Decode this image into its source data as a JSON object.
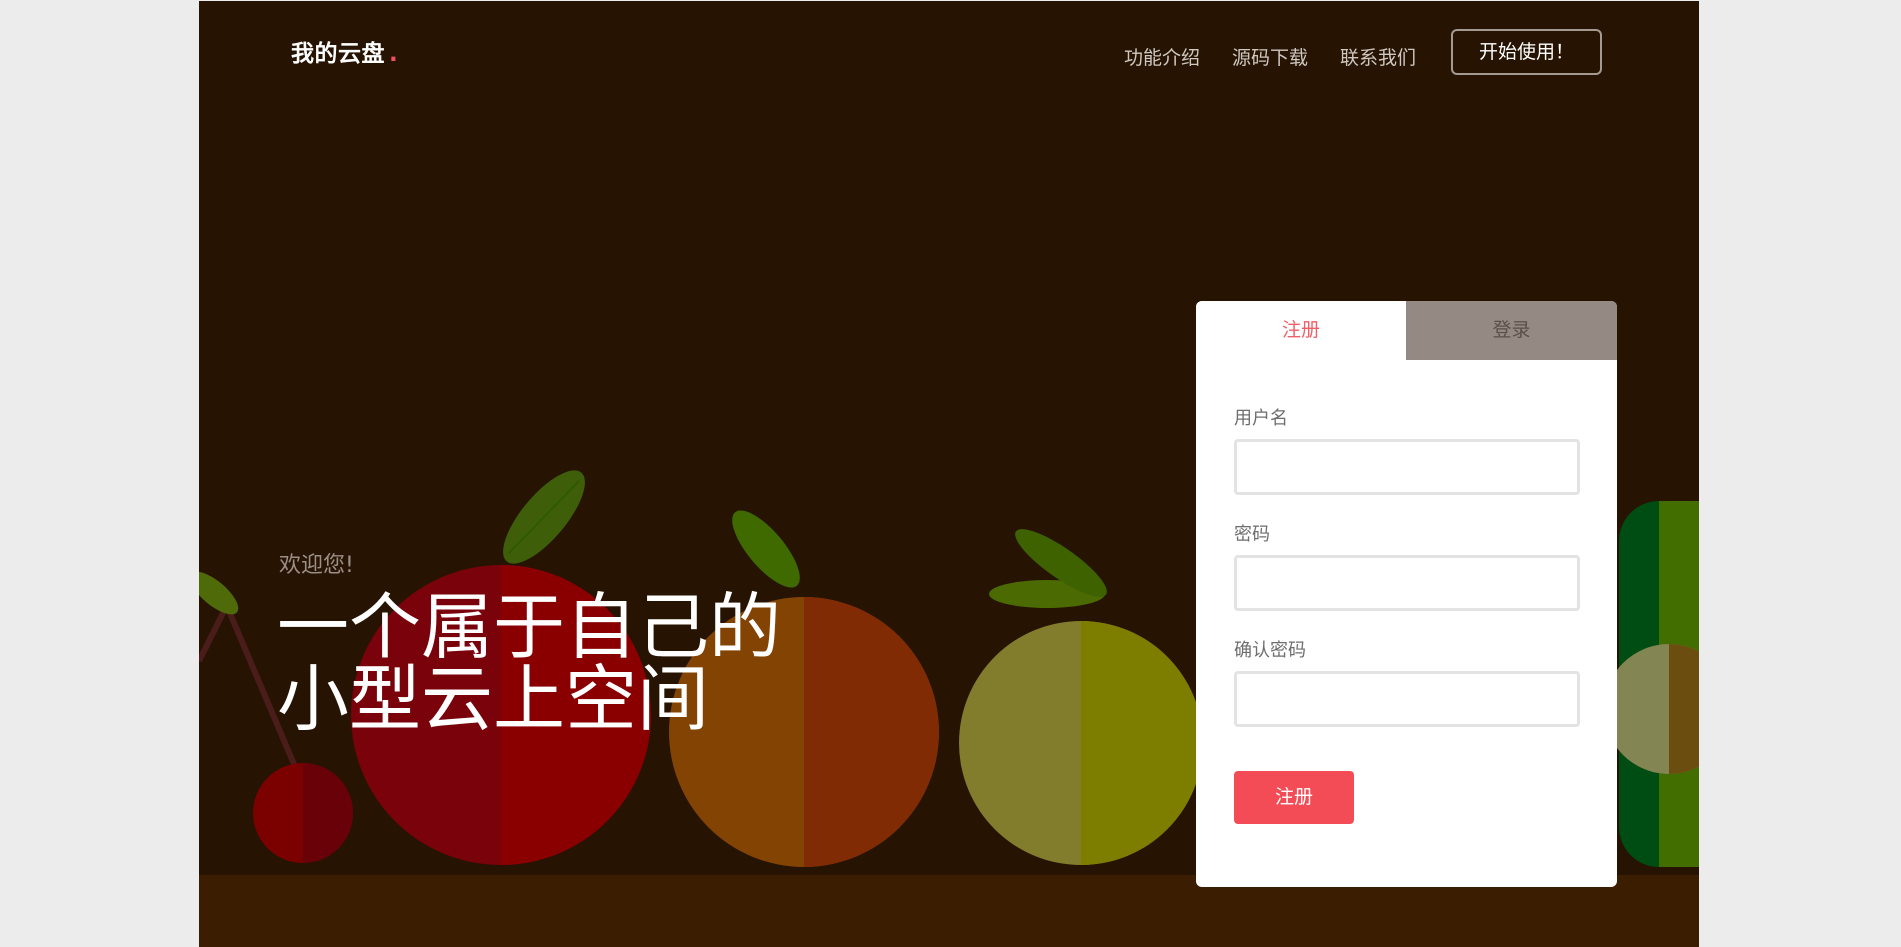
{
  "header": {
    "logo": "我的云盘",
    "logo_dot": ".",
    "nav": [
      "功能介绍",
      "源码下载",
      "联系我们"
    ],
    "cta": "开始使用！"
  },
  "hero": {
    "welcome": "欢迎您!",
    "headline_line1": "一个属于自己的",
    "headline_line2": "小型云上空间"
  },
  "auth": {
    "tabs": {
      "register": "注册",
      "login": "登录"
    },
    "fields": [
      {
        "label": "用户名",
        "value": ""
      },
      {
        "label": "密码",
        "value": ""
      },
      {
        "label": "确认密码",
        "value": ""
      }
    ],
    "submit": "注册"
  },
  "colors": {
    "background": "#261302",
    "accent": "#f34c57",
    "tab_inactive": "#958a83"
  }
}
